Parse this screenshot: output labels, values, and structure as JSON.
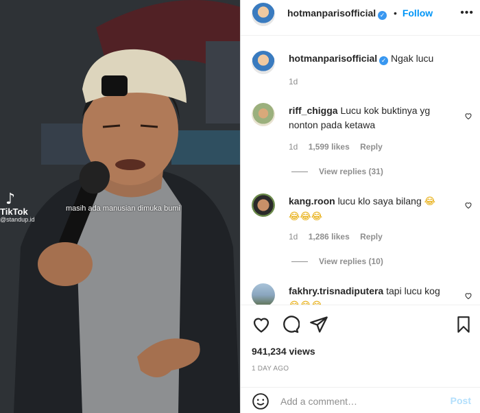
{
  "video": {
    "watermark_logo": "TikTok",
    "watermark_handle": "@standup.id",
    "caption": "masih ada manusian dimuka bumi"
  },
  "header": {
    "username": "hotmanparisofficial",
    "separator": "•",
    "follow_label": "Follow",
    "more_icon": "more-options-icon"
  },
  "comments": [
    {
      "username": "hotmanparisofficial",
      "verified": true,
      "text": "Ngak lucu",
      "time": "1d"
    },
    {
      "username": "riff_chigga",
      "text": "Lucu kok buktinya yg nonton pada ketawa",
      "time": "1d",
      "likes": "1,599 likes",
      "reply": "Reply",
      "view_replies": "View replies (31)"
    },
    {
      "username": "kang.roon",
      "text": "lucu klo saya bilang",
      "emoji_inline": "😂",
      "emoji_line": "😂😂😂",
      "time": "1d",
      "likes": "1,286 likes",
      "reply": "Reply",
      "view_replies": "View replies (10)"
    },
    {
      "username": "fakhry.trisnadiputera",
      "text": "tapi lucu kog",
      "emoji_line": "😂😂😂"
    }
  ],
  "actions": {
    "like_icon": "heart-icon",
    "comment_icon": "comment-icon",
    "share_icon": "send-icon",
    "save_icon": "bookmark-icon"
  },
  "views": "941,234 views",
  "time_ago": "1 DAY AGO",
  "comment_input": {
    "placeholder": "Add a comment…",
    "post_label": "Post",
    "emoji_icon": "smiley-icon"
  },
  "colors": {
    "link_blue": "#0095f6",
    "verified_blue": "#3897f0",
    "muted": "#8e8e8e",
    "post_disabled": "#b2dffc"
  }
}
